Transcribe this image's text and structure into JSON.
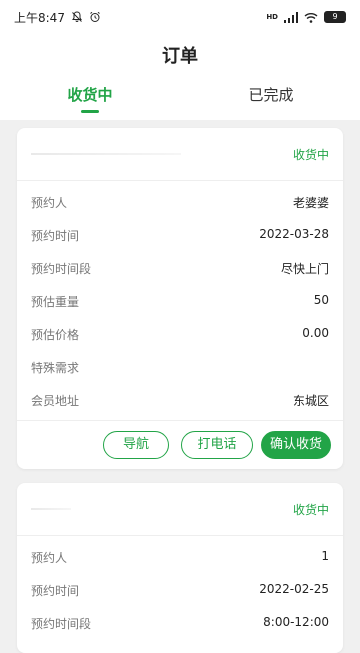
{
  "status_bar": {
    "time": "上午8:47",
    "network": "HD",
    "battery": "9"
  },
  "header": {
    "title": "订单",
    "tabs": [
      {
        "label": "收货中"
      },
      {
        "label": "已完成"
      }
    ]
  },
  "orders": [
    {
      "status": "收货中",
      "fields": [
        {
          "label": "预约人",
          "value": "老婆婆"
        },
        {
          "label": "预约时间",
          "value": "2022-03-28"
        },
        {
          "label": "预约时间段",
          "value": "尽快上门"
        },
        {
          "label": "预估重量",
          "value": "50"
        },
        {
          "label": "预估价格",
          "value": "0.00"
        },
        {
          "label": "特殊需求",
          "value": ""
        },
        {
          "label": "会员地址",
          "value": "东城区"
        }
      ],
      "actions": {
        "navigate": "导航",
        "call": "打电话",
        "confirm": "确认收货"
      }
    },
    {
      "status": "收货中",
      "fields": [
        {
          "label": "预约人",
          "value": "1"
        },
        {
          "label": "预约时间",
          "value": "2022-02-25"
        },
        {
          "label": "预约时间段",
          "value": "8:00-12:00"
        }
      ]
    }
  ],
  "colors": {
    "accent": "#22a447",
    "background": "#f0f0f0"
  }
}
